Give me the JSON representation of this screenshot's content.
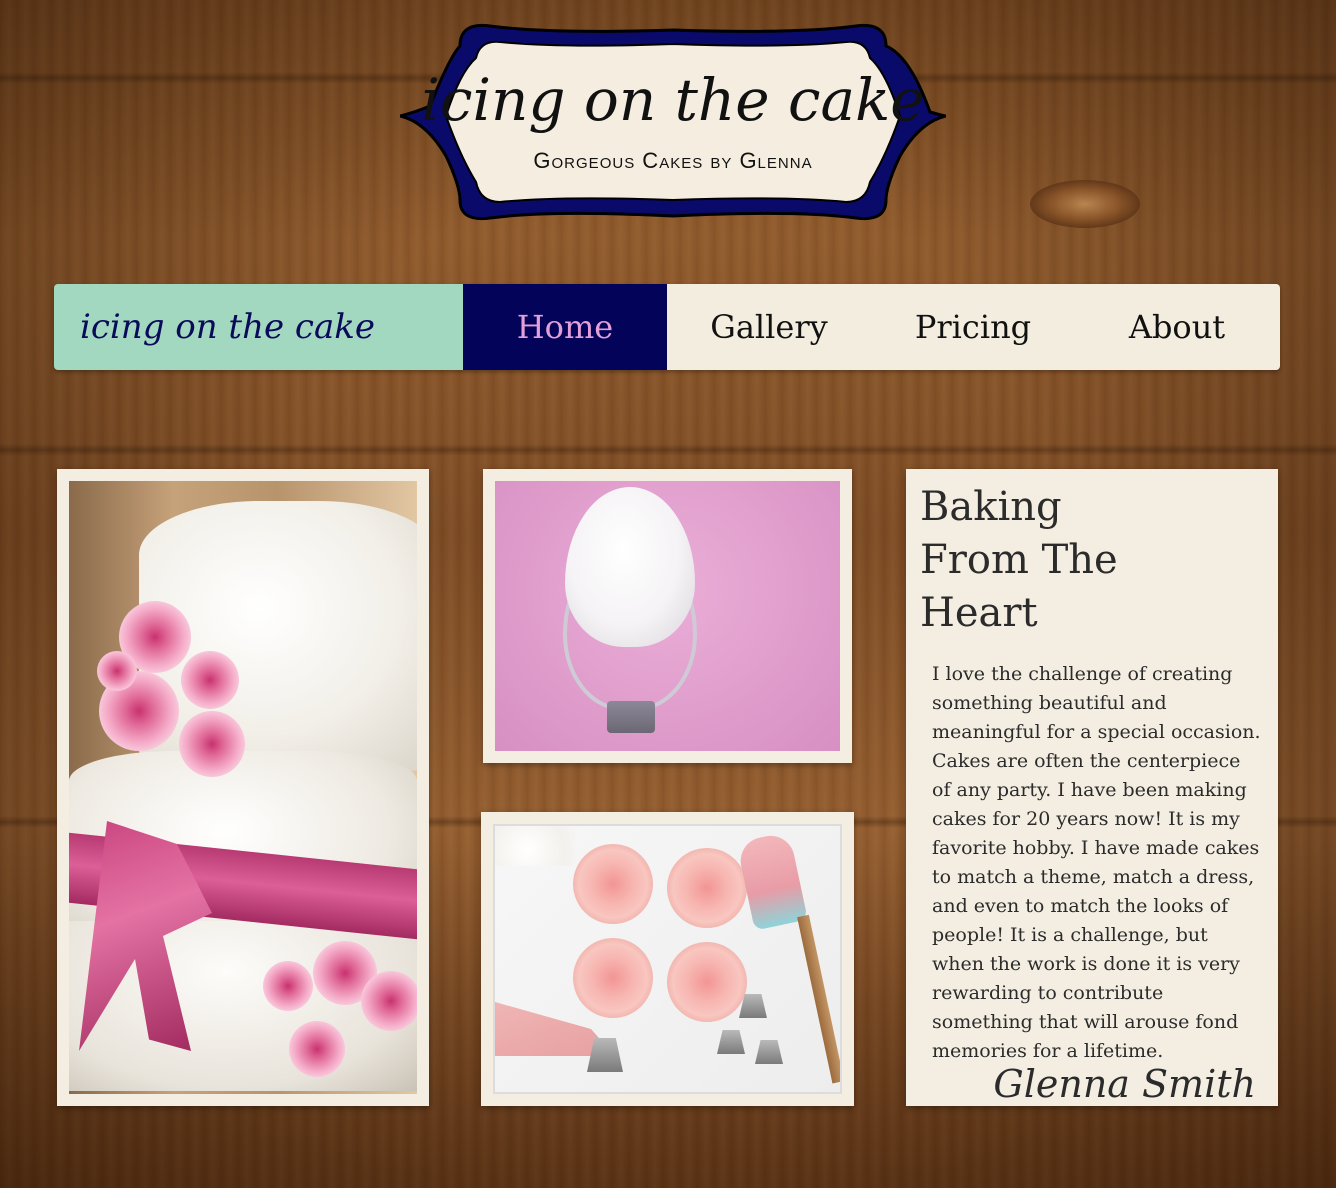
{
  "logo": {
    "title": "icing on the cake",
    "subtitle": "Gorgeous Cakes by Glenna",
    "colors": {
      "border": "#0a0a6a",
      "fill": "#f4ede0"
    }
  },
  "nav": {
    "brand": "icing on the cake",
    "items": [
      {
        "label": "Home",
        "active": true
      },
      {
        "label": "Gallery",
        "active": false
      },
      {
        "label": "Pricing",
        "active": false
      },
      {
        "label": "About",
        "active": false
      }
    ],
    "colors": {
      "brand_bg": "#a3d8c0",
      "active_bg": "#03035a",
      "active_text": "#e39fd8",
      "bar_bg": "#f3ede0"
    }
  },
  "images": [
    {
      "name": "wedding-cake-photo"
    },
    {
      "name": "meringue-whisk-photo"
    },
    {
      "name": "cupcakes-photo"
    }
  ],
  "article": {
    "heading": "Baking From The Heart",
    "body": "I love the challenge of creating something beautiful and meaningful for a special occasion. Cakes are often the centerpiece of any party. I have been making cakes for 20 years now! It is my favorite hobby. I have made cakes to match a theme, match a dress, and even to match the looks of people! It is a challenge, but when the work is done it is very rewarding to contribute something that will arouse fond memories for a lifetime.",
    "signature": "Glenna Smith"
  }
}
